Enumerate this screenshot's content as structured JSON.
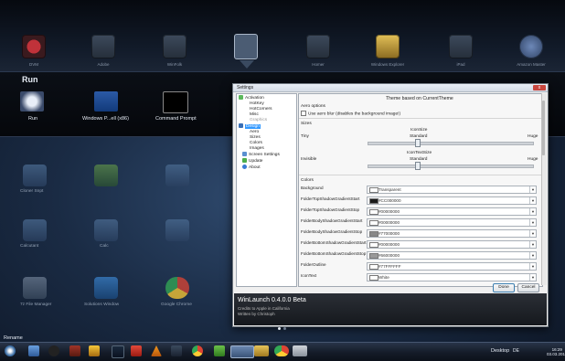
{
  "top_dock": {
    "items": [
      "DVM",
      "Adobe",
      "WinFolk",
      "",
      "Homer",
      "Windows Explorer",
      "iPad",
      "Amazon Master"
    ]
  },
  "run_panel": {
    "title": "Run",
    "items": [
      "Run",
      "Windows P...ell (x86)",
      "Command Prompt"
    ]
  },
  "desktop_icons": {
    "row1": [
      "Cloner Snpt",
      "",
      "",
      ""
    ],
    "row2": [
      "Calcutant",
      "Calc",
      "",
      ""
    ],
    "row3": [
      "7z File Manager",
      "Solutions Window",
      "Google Chrome"
    ]
  },
  "settings": {
    "window_title": "Settings",
    "close_label": "x",
    "tree": {
      "activation": "Activation",
      "hotkey": "HotKey",
      "hotcorners": "HotCorners",
      "misc": "Misc",
      "graphics": "Graphics",
      "design": "Design",
      "aero": "Aero",
      "sizes": "Sizes",
      "colors": "Colors",
      "images": "Images",
      "screen_settings": "Screen Settings",
      "update": "Update",
      "about": "About"
    },
    "theme_heading": "Theme based on CurrentTheme",
    "aero_section": "Aero options",
    "aero_checkbox": "Use aero blur (disables the background image!)",
    "sizes_section": "Sizes",
    "icon_size_label": "IconSize",
    "icon_size_min": "Tiny",
    "icon_size_mid": "Standard",
    "icon_size_max": "Huge",
    "icon_text_size_label": "IconTextSize",
    "icon_text_min": "Invisible",
    "icon_text_mid": "Standard",
    "icon_text_max": "Huge",
    "colors_section": "Colors",
    "color_rows": [
      {
        "label": "Background",
        "value": "Transparent",
        "swatch": "#ffffff"
      },
      {
        "label": "FolderTopShadowGradientStart",
        "value": "#CC000000",
        "swatch": "#1a1a1a"
      },
      {
        "label": "FolderTopShadowGradientStop",
        "value": "#00000000",
        "swatch": "#ffffff"
      },
      {
        "label": "FolderBodyShadowGradientStart",
        "value": "#00000000",
        "swatch": "#ffffff"
      },
      {
        "label": "FolderBodyShadowGradientStop",
        "value": "#77000000",
        "swatch": "#888888"
      },
      {
        "label": "FolderBottomShadowGradientStart",
        "value": "#00000000",
        "swatch": "#ffffff"
      },
      {
        "label": "FolderBottomShadowGradientStop",
        "value": "#66000000",
        "swatch": "#999999"
      },
      {
        "label": "FolderOutline",
        "value": "#77FFFFFF",
        "swatch": "#ffffff"
      },
      {
        "label": "IconText",
        "value": "White",
        "swatch": "#ffffff"
      }
    ],
    "done_label": "Done",
    "cancel_label": "Cancel",
    "app_name": "WinLaunch 0.4.0.0 Beta",
    "credits": "Credits to Apple in California",
    "author": "Written by Christoph"
  },
  "bottom": {
    "rename_label": "Rename",
    "desktop_label": "Desktop",
    "lang": "DE",
    "clock": "16:29\n03.03.2013"
  }
}
